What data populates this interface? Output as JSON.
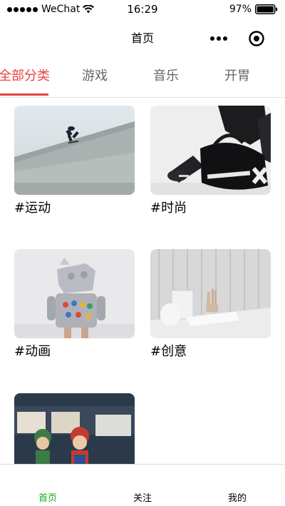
{
  "status_bar": {
    "carrier": "WeChat",
    "time": "16:29",
    "battery": "97%"
  },
  "nav": {
    "title": "首页",
    "more_icon": "more-dots-icon",
    "close_icon": "target-close-icon"
  },
  "tabs": [
    {
      "label": "全部分类",
      "active": true
    },
    {
      "label": "游戏",
      "active": false
    },
    {
      "label": "音乐",
      "active": false
    },
    {
      "label": "开胃",
      "active": false
    }
  ],
  "cards": [
    {
      "label": "#运动",
      "image": "skateboarder-photo"
    },
    {
      "label": "#时尚",
      "image": "gym-bag-photo"
    },
    {
      "label": "#动画",
      "image": "robot-costume-photo"
    },
    {
      "label": "#创意",
      "image": "still-life-photo"
    },
    {
      "label": "",
      "image": "mario-figures-photo"
    }
  ],
  "tabbar": [
    {
      "label": "首页",
      "active": true
    },
    {
      "label": "关注",
      "active": false
    },
    {
      "label": "我的",
      "active": false
    }
  ],
  "colors": {
    "accent_red": "#e64340",
    "tabbar_active": "#1aad19"
  }
}
